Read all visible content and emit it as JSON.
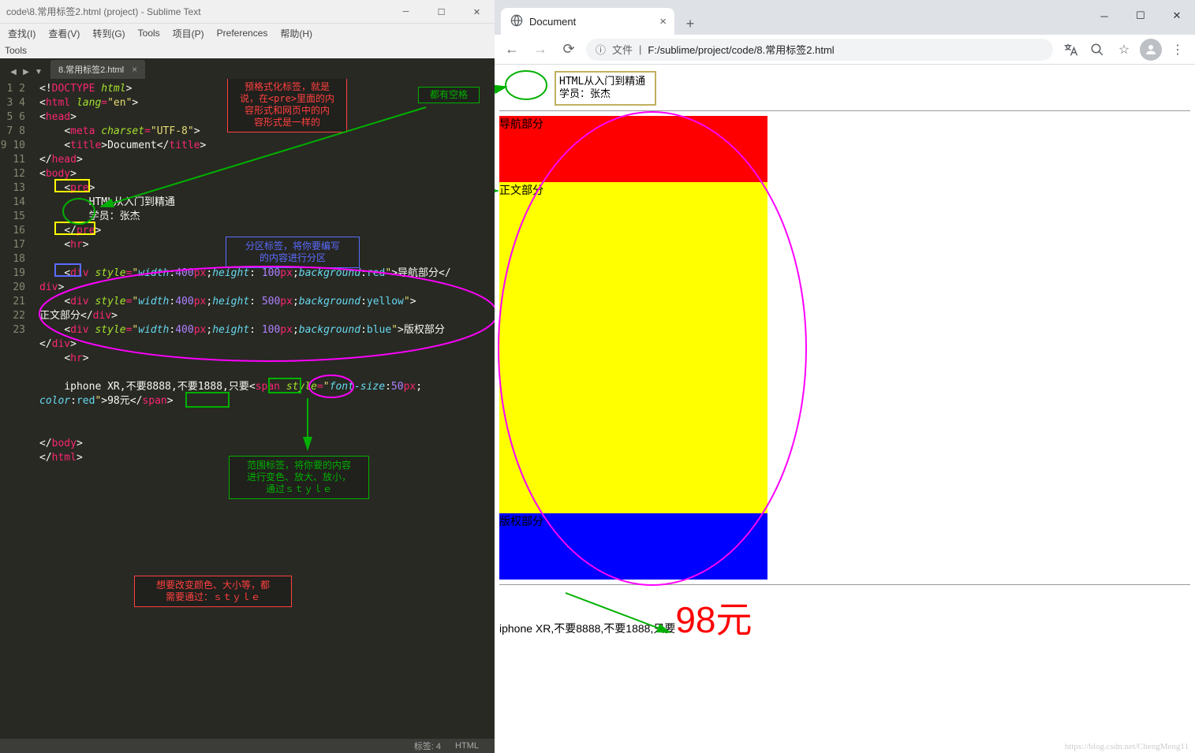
{
  "sublime": {
    "window_title": "code\\8.常用标签2.html (project) - Sublime Text",
    "menubar": [
      "查找(I)",
      "查看(V)",
      "转到(G)",
      "Tools",
      "项目(P)",
      "Preferences",
      "帮助(H)"
    ],
    "toolbar_label": "Tools",
    "tab_label": "8.常用标签2.html",
    "status_left": "标签: 4",
    "status_right": "HTML",
    "code_lines": [
      "<!DOCTYPE html>",
      "<html lang=\"en\">",
      "<head>",
      "    <meta charset=\"UTF-8\">",
      "    <title>Document</title>",
      "</head>",
      "<body>",
      "    <pre>",
      "        HTML从入门到精通",
      "        学员：张杰",
      "    </pre>",
      "    <hr>",
      "",
      "    <div style=\"width:400px;height: 100px;background:red\">导航部分</div>",
      "    <div style=\"width:400px;height: 500px;background:yellow\">正文部分</div>",
      "    <div style=\"width:400px;height: 100px;background:blue\">版权部分</div>",
      "    <hr>",
      "",
      "    iphone XR,不要8888,不要1888,只要<span style=\"font-size:50px;color:red\">98元</span>",
      "",
      "",
      "</body>",
      "</html>"
    ],
    "line_numbers": [
      "1",
      "2",
      "3",
      "4",
      "5",
      "6",
      "7",
      "8",
      "9",
      "10",
      "11",
      "12",
      "13",
      "14",
      "15",
      "16",
      "17",
      "18",
      "19",
      "20",
      "21",
      "22",
      "23"
    ],
    "annotations": {
      "box_red_top": "预格式化标签，就是\n说，在<pre>里面的内\n容形式和网页中的内\n容形式是一样的",
      "box_green_sm_label": "都有空格",
      "box_blue_mid": "分区标签，将你要编写\n的内容进行分区",
      "box_green_low": "范围标签，将你要的内容\n进行变色、放大、放小，\n通过ｓｔｙｌｅ",
      "box_red_low": "想要改变颜色、大小等，都\n需要通过：ｓｔｙｌｅ"
    }
  },
  "chrome": {
    "tab_title": "Document",
    "url_prefix": "文件",
    "url_path": "F:/sublime/project/code/8.常用标签2.html",
    "page": {
      "pre_line1": "HTML从入门到精通",
      "pre_line2": "学员：张杰",
      "nav_text": "导航部分",
      "main_text": "正文部分",
      "foot_text": "版权部分",
      "iphone_text": "iphone XR,不要8888,不要1888,只要",
      "price_text": "98元"
    },
    "watermark": "https://blog.csdn.net/ChengMeng11"
  }
}
